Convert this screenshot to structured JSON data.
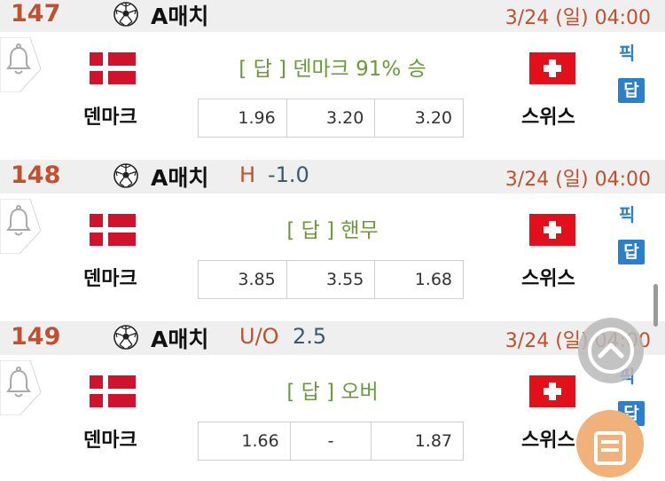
{
  "matches": [
    {
      "number": "147",
      "league": "A매치",
      "handicap_type": "",
      "handicap_value": "",
      "datetime": "3/24 (일)  04:00",
      "result_text": "[ 답 ]  덴마크 91% 승",
      "home_team": "덴마크",
      "away_team": "스위스",
      "odds": [
        "1.96",
        "3.20",
        "3.20"
      ],
      "pick_label": "픽",
      "answer_label": "답"
    },
    {
      "number": "148",
      "league": "A매치",
      "handicap_type": "H",
      "handicap_value": "-1.0",
      "datetime": "3/24 (일)  04:00",
      "result_text": "[ 답 ] 핸무",
      "home_team": "덴마크",
      "away_team": "스위스",
      "odds": [
        "3.85",
        "3.55",
        "1.68"
      ],
      "pick_label": "픽",
      "answer_label": "답"
    },
    {
      "number": "149",
      "league": "A매치",
      "handicap_type": "U/O",
      "handicap_value": "2.5",
      "datetime": "3/24 (일)  04:00",
      "result_text": "[ 답 ] 오버",
      "home_team": "덴마크",
      "away_team": "스위스",
      "odds": [
        "1.66",
        "-",
        "1.87"
      ],
      "pick_label": "픽",
      "answer_label": "답"
    }
  ],
  "colors": {
    "number": "#c0502e",
    "result": "#6a9a3c",
    "pick": "#2e7fc9",
    "handicap_value": "#3d5a6b",
    "header_bg": "#efefef",
    "scroll_top_button": "#b9b9b9",
    "menu_button": "#f0b27a"
  },
  "icons": {
    "ball": "soccer-ball-icon",
    "alarm": "bell-icon",
    "scroll_top": "chevron-up-icon",
    "menu": "list-icon"
  }
}
